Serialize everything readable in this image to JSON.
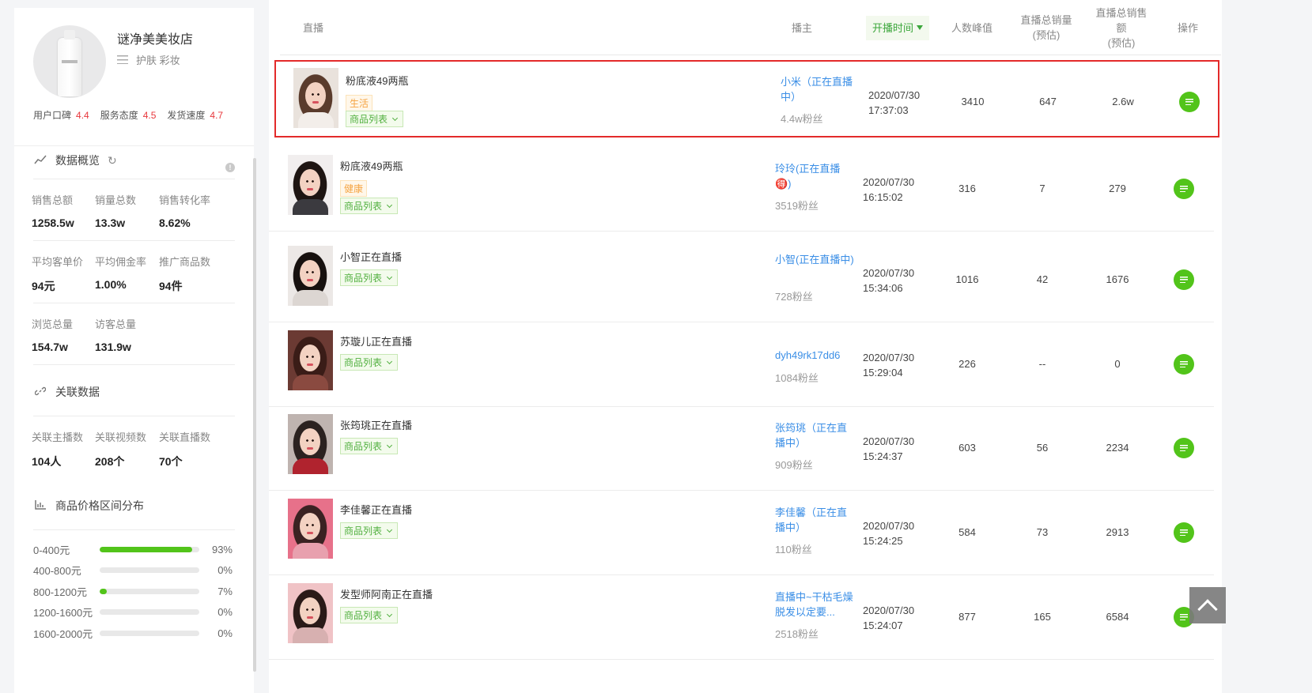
{
  "shop": {
    "name": "谜净美美妆店",
    "category": "护肤 彩妆",
    "ratings": [
      {
        "label": "用户口碑",
        "value": "4.4"
      },
      {
        "label": "服务态度",
        "value": "4.5"
      },
      {
        "label": "发货速度",
        "value": "4.7"
      }
    ]
  },
  "overview": {
    "title": "数据概览",
    "stats": [
      {
        "label": "销售总额",
        "value": "1258.5w"
      },
      {
        "label": "销量总数",
        "value": "13.3w"
      },
      {
        "label": "销售转化率",
        "value": "8.62%"
      },
      {
        "label": "平均客单价",
        "value": "94元"
      },
      {
        "label": "平均佣金率",
        "value": "1.00%"
      },
      {
        "label": "推广商品数",
        "value": "94件"
      },
      {
        "label": "浏览总量",
        "value": "154.7w"
      },
      {
        "label": "访客总量",
        "value": "131.9w"
      }
    ]
  },
  "related": {
    "title": "关联数据",
    "stats": [
      {
        "label": "关联主播数",
        "value": "104人"
      },
      {
        "label": "关联视频数",
        "value": "208个"
      },
      {
        "label": "关联直播数",
        "value": "70个"
      }
    ]
  },
  "price_dist": {
    "title": "商品价格区间分布",
    "rows": [
      {
        "range": "0-400元",
        "pct": "93%",
        "fill": 93
      },
      {
        "range": "400-800元",
        "pct": "0%",
        "fill": 0
      },
      {
        "range": "800-1200元",
        "pct": "7%",
        "fill": 7
      },
      {
        "range": "1200-1600元",
        "pct": "0%",
        "fill": 0
      },
      {
        "range": "1600-2000元",
        "pct": "0%",
        "fill": 0
      }
    ]
  },
  "table": {
    "headers": {
      "live": "直播",
      "host": "播主",
      "start_time": "开播时间",
      "peak": "人数峰值",
      "sales_qty": "直播总销量(预估)",
      "sales_amt": "直播总销售额(预估)",
      "op": "操作"
    },
    "rows": [
      {
        "title": "粉底液49两瓶",
        "tag": "生活",
        "product_btn": "商品列表",
        "host": "小米（正在直播中）",
        "fans": "4.4w粉丝",
        "date": "2020/07/30",
        "time": "17:37:03",
        "peak": "3410",
        "qty": "647",
        "amt": "2.6w"
      },
      {
        "title": "粉底液49两瓶",
        "tag": "健康",
        "product_btn": "商品列表",
        "host": "玲玲(正在直播🉐)",
        "fans": "3519粉丝",
        "date": "2020/07/30",
        "time": "16:15:02",
        "peak": "316",
        "qty": "7",
        "amt": "279"
      },
      {
        "title": "小智正在直播",
        "tag": "",
        "product_btn": "商品列表",
        "host": "小智(正在直播中)",
        "fans": "728粉丝",
        "date": "2020/07/30",
        "time": "15:34:06",
        "peak": "1016",
        "qty": "42",
        "amt": "1676"
      },
      {
        "title": "苏璇儿正在直播",
        "tag": "",
        "product_btn": "商品列表",
        "host": "dyh49rk17dd6",
        "fans": "1084粉丝",
        "date": "2020/07/30",
        "time": "15:29:04",
        "peak": "226",
        "qty": "--",
        "amt": "0"
      },
      {
        "title": "张筠珧正在直播",
        "tag": "",
        "product_btn": "商品列表",
        "host": "张筠珧（正在直播中）",
        "fans": "909粉丝",
        "date": "2020/07/30",
        "time": "15:24:37",
        "peak": "603",
        "qty": "56",
        "amt": "2234"
      },
      {
        "title": "李佳馨正在直播",
        "tag": "",
        "product_btn": "商品列表",
        "host": "李佳馨（正在直播中）",
        "fans": "110粉丝",
        "date": "2020/07/30",
        "time": "15:24:25",
        "peak": "584",
        "qty": "73",
        "amt": "2913"
      },
      {
        "title": "发型师阿南正在直播",
        "tag": "",
        "product_btn": "商品列表",
        "host": "直播中~干枯毛燥脱发以定要...",
        "fans": "2518粉丝",
        "date": "2020/07/30",
        "time": "15:24:07",
        "peak": "877",
        "qty": "165",
        "amt": "6584"
      }
    ]
  },
  "colors": {
    "accent": "#52c41a",
    "link": "#3a8ee6",
    "highlight": "#e32a2a",
    "rating": "#e8383d"
  },
  "icons": {
    "refresh": "refresh-icon",
    "info": "info-icon",
    "link": "link-icon",
    "chart": "bar-chart-icon",
    "op": "detail-icon",
    "back_to_top": "arrow-up-icon"
  }
}
